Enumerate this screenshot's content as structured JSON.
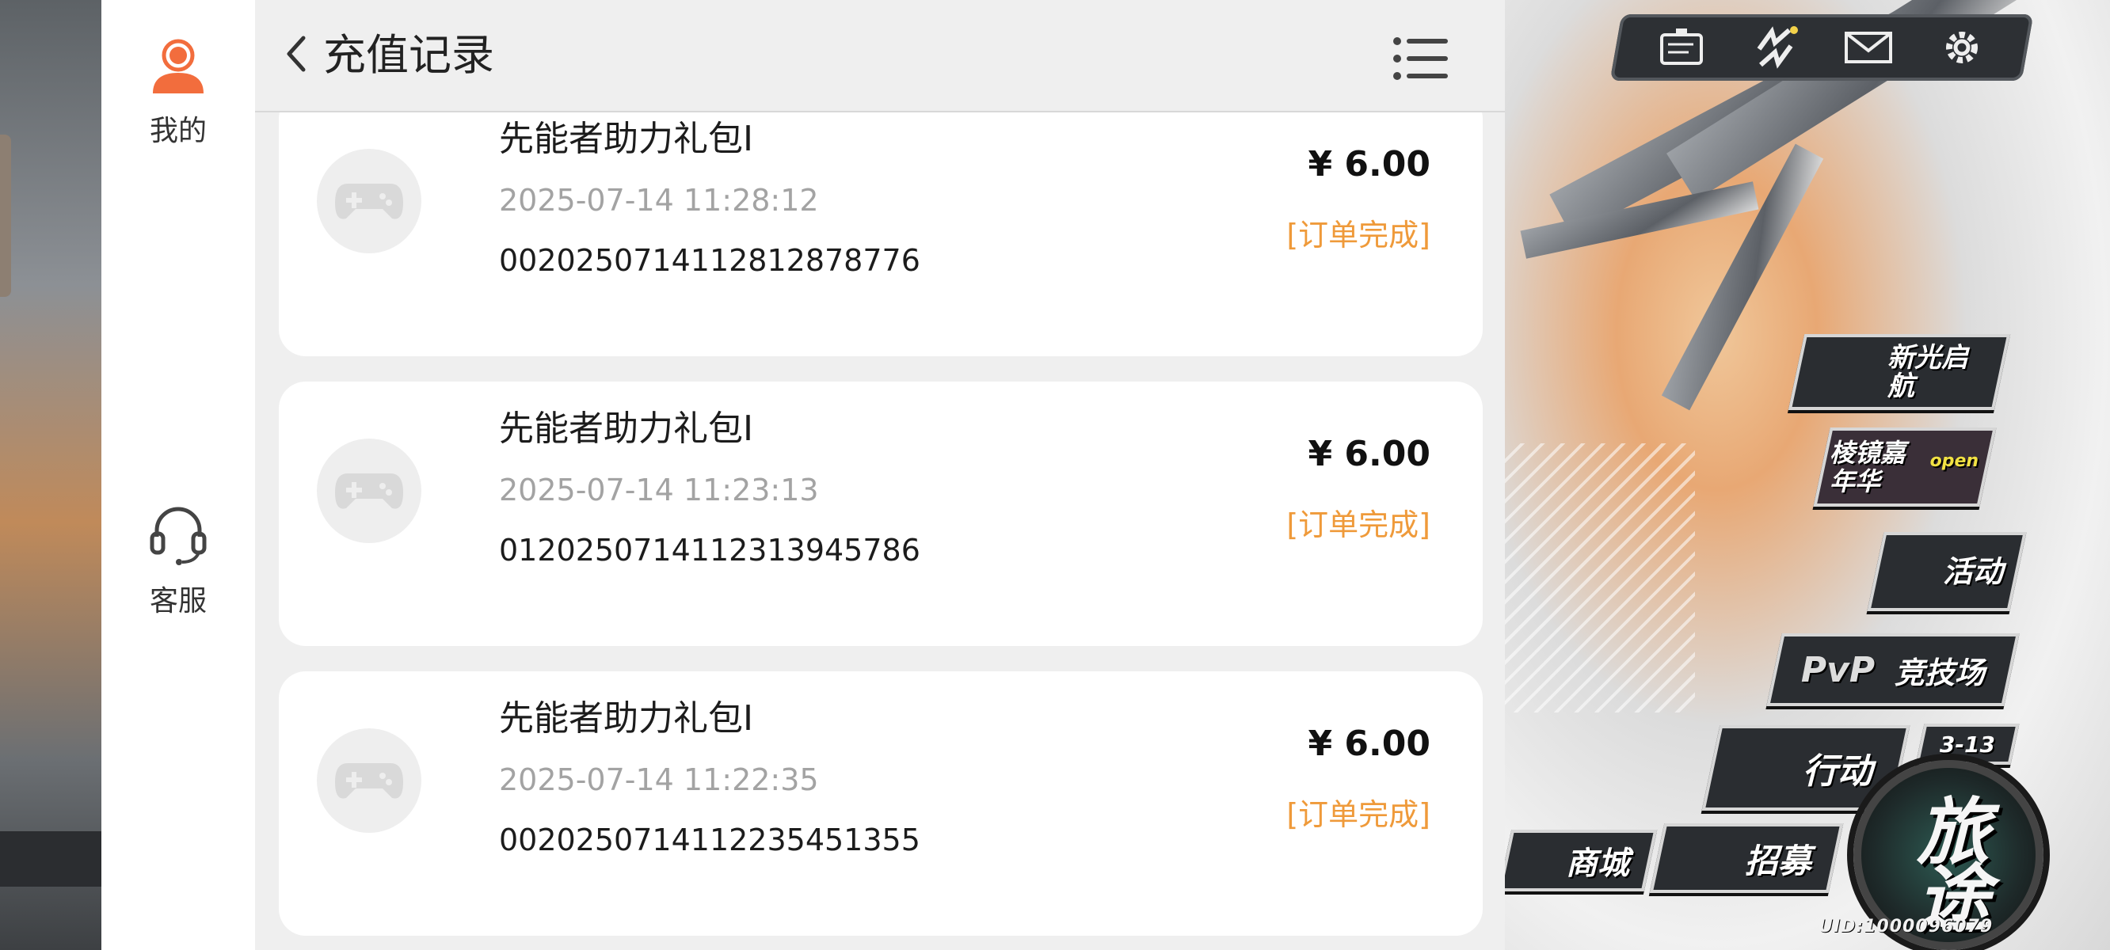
{
  "sidebar": {
    "items": [
      {
        "label": "我的",
        "icon": "user-icon"
      },
      {
        "label": "客服",
        "icon": "headset-icon"
      }
    ]
  },
  "header": {
    "title": "充值记录",
    "back_icon": "chevron-left-icon",
    "menu_icon": "list-menu-icon"
  },
  "records": [
    {
      "name": "先能者助力礼包I",
      "time": "2025-07-14 11:28:12",
      "order_id": "002025071411281287877​6",
      "price": "¥ 6.00",
      "status": "[订单完成]"
    },
    {
      "name": "先能者助力礼包I",
      "time": "2025-07-14 11:23:13",
      "order_id": "0120250714112313945786",
      "price": "¥ 6.00",
      "status": "[订单完成]"
    },
    {
      "name": "先能者助力礼包I",
      "time": "2025-07-14 11:22:35",
      "order_id": "0020250714112235451355",
      "price": "¥ 6.00",
      "status": "[订单完成]"
    }
  ],
  "game": {
    "buttons": {
      "event1": "新光启航",
      "event2": "棱镜嘉年华",
      "event2_sign": "open",
      "activity": "活动",
      "pvp_tag": "PvP",
      "pvp": "竞技场",
      "action": "行动",
      "stage": "3-13",
      "shop": "商城",
      "recruit": "招募",
      "journey": "旅途"
    },
    "uid": "UID:1000096079"
  },
  "colors": {
    "status_orange": "#ef9a3a",
    "panel_bg": "#efefef",
    "accent_user": "#f26d3d"
  }
}
